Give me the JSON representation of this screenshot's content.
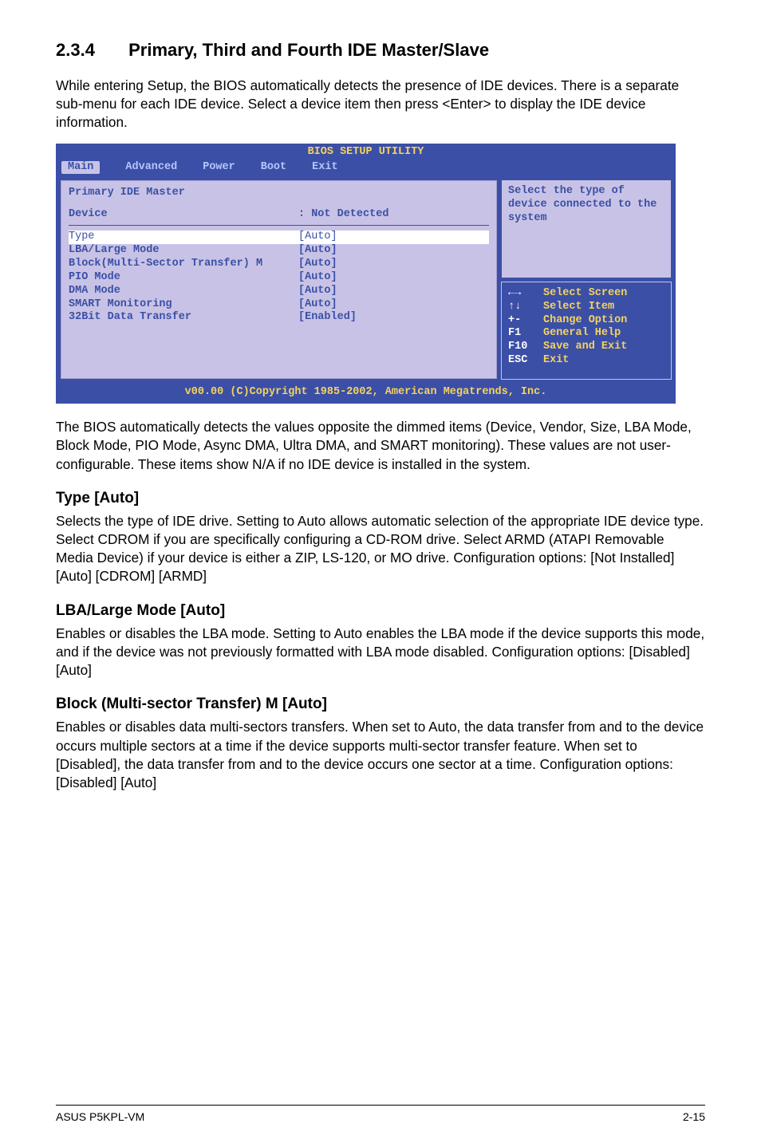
{
  "section": {
    "number": "2.3.4",
    "title": "Primary, Third and Fourth IDE Master/Slave",
    "intro": "While entering Setup, the BIOS automatically detects the presence of IDE devices. There is a separate sub-menu for each IDE device. Select a device item then press <Enter> to display the IDE device information."
  },
  "bios": {
    "utility_title": "BIOS SETUP UTILITY",
    "tabs": [
      "Main",
      "Advanced",
      "Power",
      "Boot",
      "Exit"
    ],
    "active_tab": "Main",
    "panel_title": "Primary IDE Master",
    "device_label": "Device",
    "device_value": ": Not Detected",
    "rows": [
      {
        "label": "Type",
        "value": "[Auto]",
        "highlight": true
      },
      {
        "label": "LBA/Large Mode",
        "value": "[Auto]"
      },
      {
        "label": "Block(Multi-Sector Transfer) M",
        "value": "[Auto]"
      },
      {
        "label": "PIO Mode",
        "value": "[Auto]"
      },
      {
        "label": "DMA Mode",
        "value": "[Auto]"
      },
      {
        "label": "SMART Monitoring",
        "value": "[Auto]"
      },
      {
        "label": "32Bit Data Transfer",
        "value": "[Enabled]"
      }
    ],
    "hint": "Select the type of device connected to the system",
    "keys": [
      {
        "k": "←→",
        "v": "Select Screen"
      },
      {
        "k": "↑↓",
        "v": "Select Item"
      },
      {
        "k": "+-",
        "v": "Change Option"
      },
      {
        "k": "F1",
        "v": "General Help"
      },
      {
        "k": "F10",
        "v": "Save and Exit"
      },
      {
        "k": "ESC",
        "v": "Exit"
      }
    ],
    "footer": "v00.00 (C)Copyright 1985-2002, American Megatrends, Inc."
  },
  "para_after_bios": "The BIOS automatically detects the values opposite the dimmed items (Device, Vendor, Size, LBA Mode, Block Mode, PIO Mode, Async DMA, Ultra DMA, and SMART monitoring). These values are not user-configurable. These items show N/A if no IDE device is installed in the system.",
  "subsections": [
    {
      "title": "Type [Auto]",
      "body": "Selects the type of IDE drive. Setting to Auto allows automatic selection of the appropriate IDE device type. Select CDROM if you are specifically configuring a CD-ROM drive. Select ARMD (ATAPI Removable Media Device) if your device is either a ZIP, LS-120, or MO drive. Configuration options: [Not Installed] [Auto] [CDROM] [ARMD]"
    },
    {
      "title": "LBA/Large Mode [Auto]",
      "body": "Enables or disables the LBA mode. Setting to Auto enables the LBA mode if the device supports this mode, and if the device was not previously formatted with LBA mode disabled. Configuration options: [Disabled] [Auto]"
    },
    {
      "title": "Block (Multi-sector Transfer) M [Auto]",
      "body": "Enables or disables data multi-sectors transfers. When set to Auto, the data transfer from and to the device occurs multiple sectors at a time if the device supports multi-sector transfer feature. When set to [Disabled], the data transfer from and to the device occurs one sector at a time. Configuration options: [Disabled] [Auto]"
    }
  ],
  "footer": {
    "left": "ASUS P5KPL-VM",
    "right": "2-15"
  }
}
